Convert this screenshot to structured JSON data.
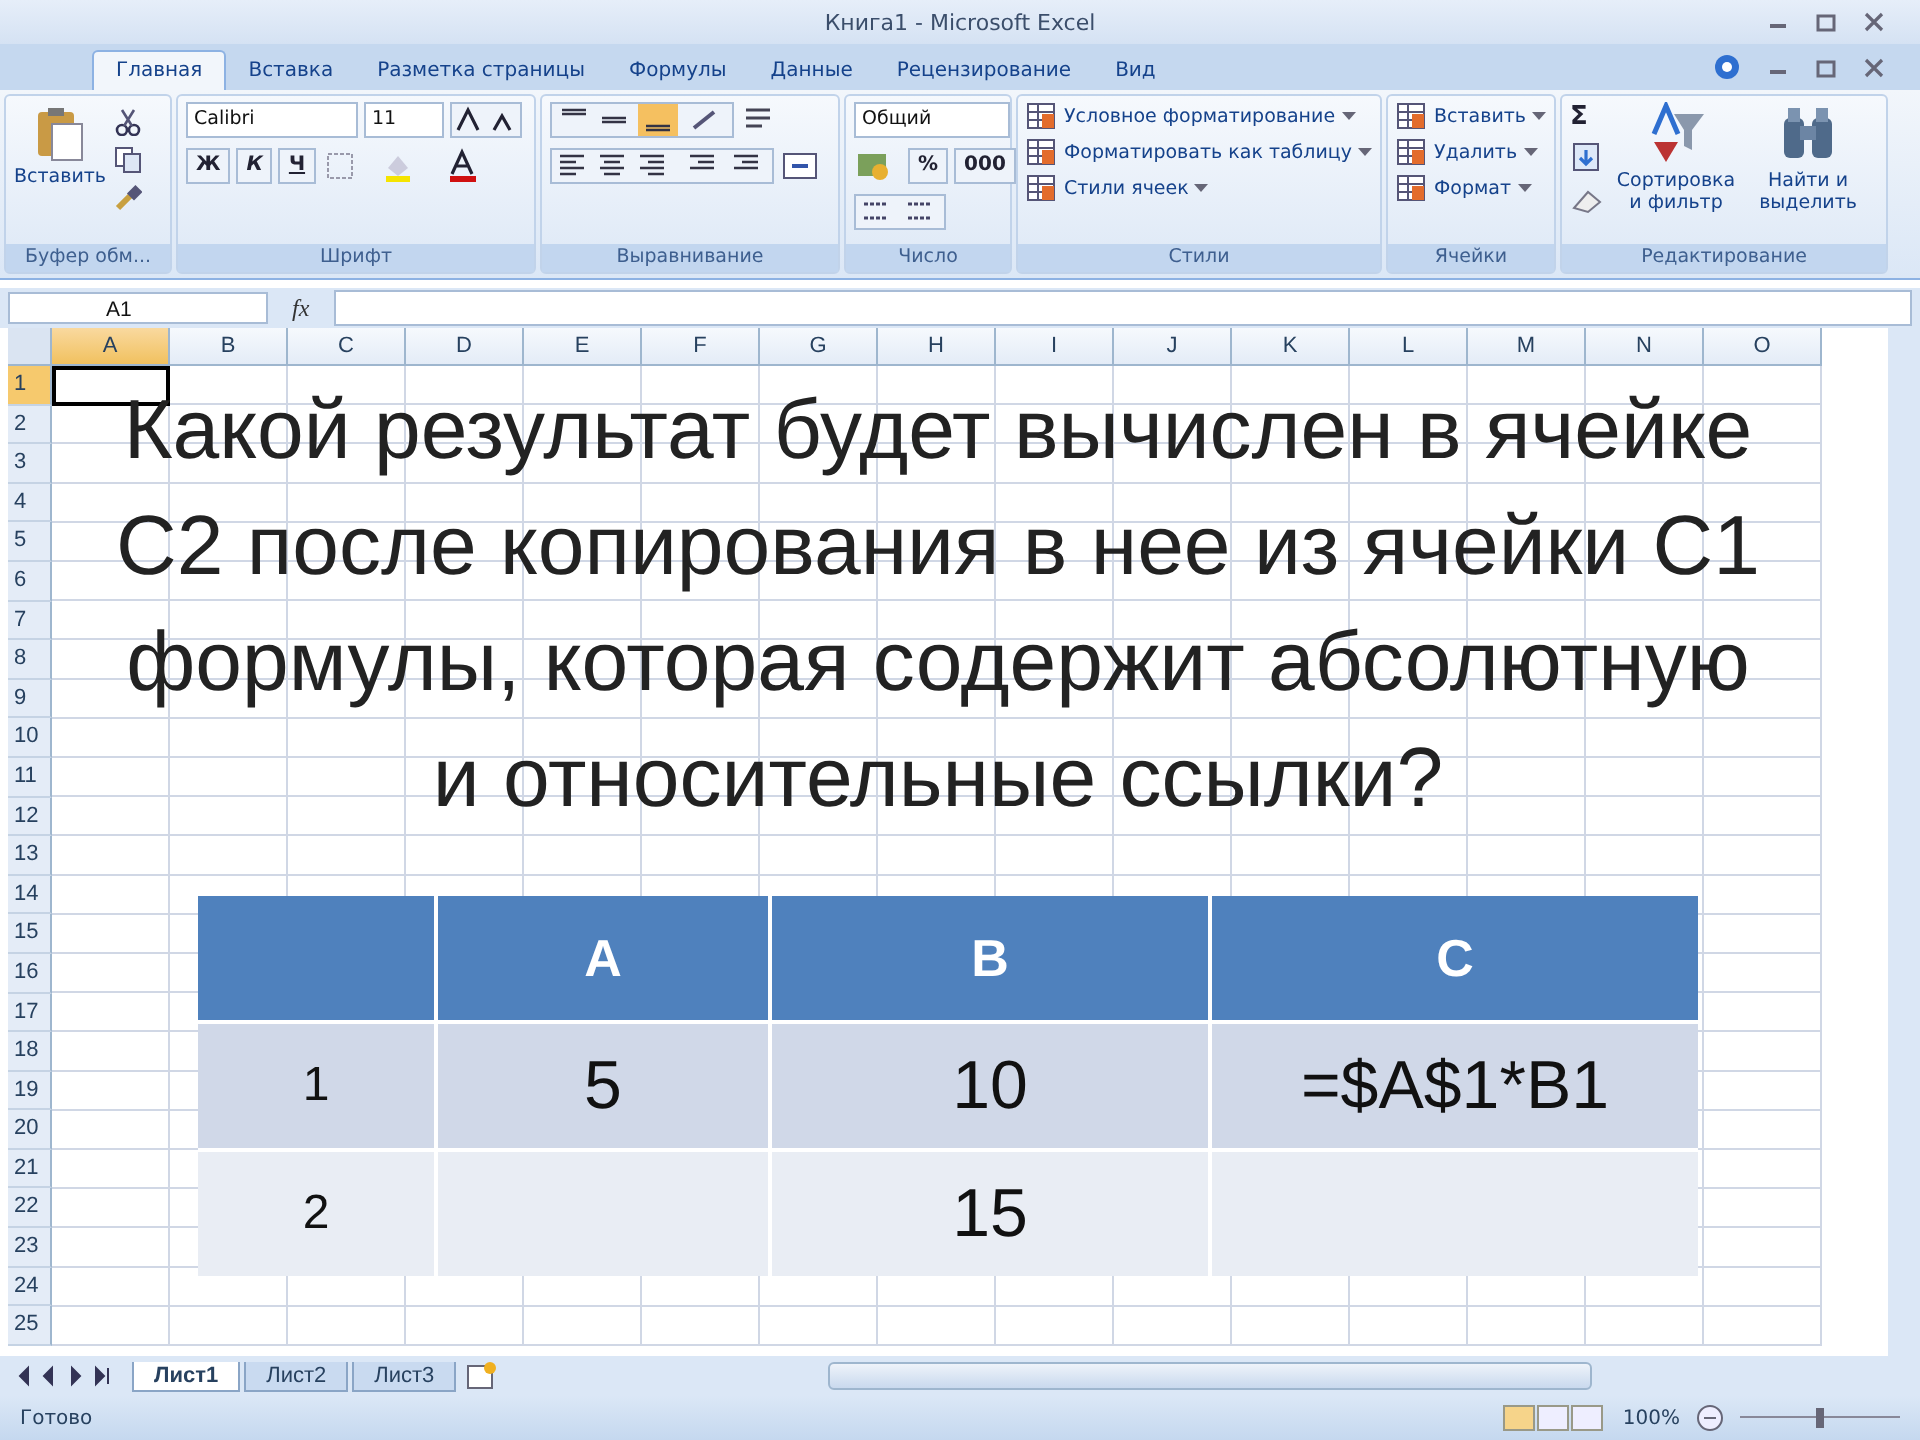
{
  "window": {
    "title": "Книга1 - Microsoft Excel"
  },
  "tabs": [
    {
      "label": "Главная",
      "selected": true
    },
    {
      "label": "Вставка",
      "selected": false
    },
    {
      "label": "Разметка страницы",
      "selected": false
    },
    {
      "label": "Формулы",
      "selected": false
    },
    {
      "label": "Данные",
      "selected": false
    },
    {
      "label": "Рецензирование",
      "selected": false
    },
    {
      "label": "Вид",
      "selected": false
    }
  ],
  "ribbon": [
    {
      "kind": "clipboard",
      "label": "Буфер обм...",
      "paste": "Вставить"
    },
    {
      "kind": "font",
      "label": "Шрифт",
      "font_name": "Calibri",
      "font_size": "11",
      "styles": [
        "Ж",
        "К",
        "Ч"
      ]
    },
    {
      "kind": "alignment",
      "label": "Выравнивание"
    },
    {
      "kind": "number",
      "label": "Число",
      "format": "Общий",
      "symbols": [
        "%",
        "000"
      ]
    },
    {
      "kind": "list",
      "label": "Стили",
      "items": [
        "Условное форматирование",
        "Форматировать как таблицу",
        "Стили ячеек"
      ]
    },
    {
      "kind": "list",
      "label": "Ячейки",
      "items": [
        "Вставить",
        "Удалить",
        "Формат"
      ]
    },
    {
      "kind": "editing",
      "label": "Редактирование",
      "symbol": "Σ",
      "buttons": [
        "Сортировка и фильтр",
        "Найти и выделить"
      ]
    }
  ],
  "formula_bar": {
    "name_box": "A1",
    "function_label": "fx"
  },
  "columns": [
    {
      "label": "A",
      "selected": true
    },
    {
      "label": "B",
      "selected": false
    },
    {
      "label": "C",
      "selected": false
    },
    {
      "label": "D",
      "selected": false
    },
    {
      "label": "E",
      "selected": false
    },
    {
      "label": "F",
      "selected": false
    },
    {
      "label": "G",
      "selected": false
    },
    {
      "label": "H",
      "selected": false
    },
    {
      "label": "I",
      "selected": false
    },
    {
      "label": "J",
      "selected": false
    },
    {
      "label": "K",
      "selected": false
    },
    {
      "label": "L",
      "selected": false
    },
    {
      "label": "M",
      "selected": false
    },
    {
      "label": "N",
      "selected": false
    },
    {
      "label": "O",
      "selected": false
    }
  ],
  "rows": [
    {
      "label": "1",
      "selected": true
    },
    {
      "label": "2",
      "selected": false
    },
    {
      "label": "3",
      "selected": false
    },
    {
      "label": "4",
      "selected": false
    },
    {
      "label": "5",
      "selected": false
    },
    {
      "label": "6",
      "selected": false
    },
    {
      "label": "7",
      "selected": false
    },
    {
      "label": "8",
      "selected": false
    },
    {
      "label": "9",
      "selected": false
    },
    {
      "label": "10",
      "selected": false
    },
    {
      "label": "11",
      "selected": false
    },
    {
      "label": "12",
      "selected": false
    },
    {
      "label": "13",
      "selected": false
    },
    {
      "label": "14",
      "selected": false
    },
    {
      "label": "15",
      "selected": false
    },
    {
      "label": "16",
      "selected": false
    },
    {
      "label": "17",
      "selected": false
    },
    {
      "label": "18",
      "selected": false
    },
    {
      "label": "19",
      "selected": false
    },
    {
      "label": "20",
      "selected": false
    },
    {
      "label": "21",
      "selected": false
    },
    {
      "label": "22",
      "selected": false
    },
    {
      "label": "23",
      "selected": false
    },
    {
      "label": "24",
      "selected": false
    },
    {
      "label": "25",
      "selected": false
    }
  ],
  "slide": {
    "question_lines": [
      "Какой результат будет вычислен в ячейке",
      "С2 после копирования в нее из ячейки С1",
      "формулы, которая содержит абсолютную",
      "и относительные ссылки?"
    ],
    "table": {
      "header": [
        "A",
        "B",
        "C"
      ],
      "rows": [
        {
          "label": "1",
          "cells": [
            "5",
            "10",
            "=$A$1*B1"
          ]
        },
        {
          "label": "2",
          "cells": [
            null,
            "15",
            null
          ]
        }
      ]
    }
  },
  "sheet_tabs": [
    {
      "label": "Лист1",
      "selected": true
    },
    {
      "label": "Лист2",
      "selected": false
    },
    {
      "label": "Лист3",
      "selected": false
    }
  ],
  "status_bar": {
    "status": "Готово",
    "zoom": "100%",
    "zoom_slider": {
      "level": 0.5
    }
  }
}
